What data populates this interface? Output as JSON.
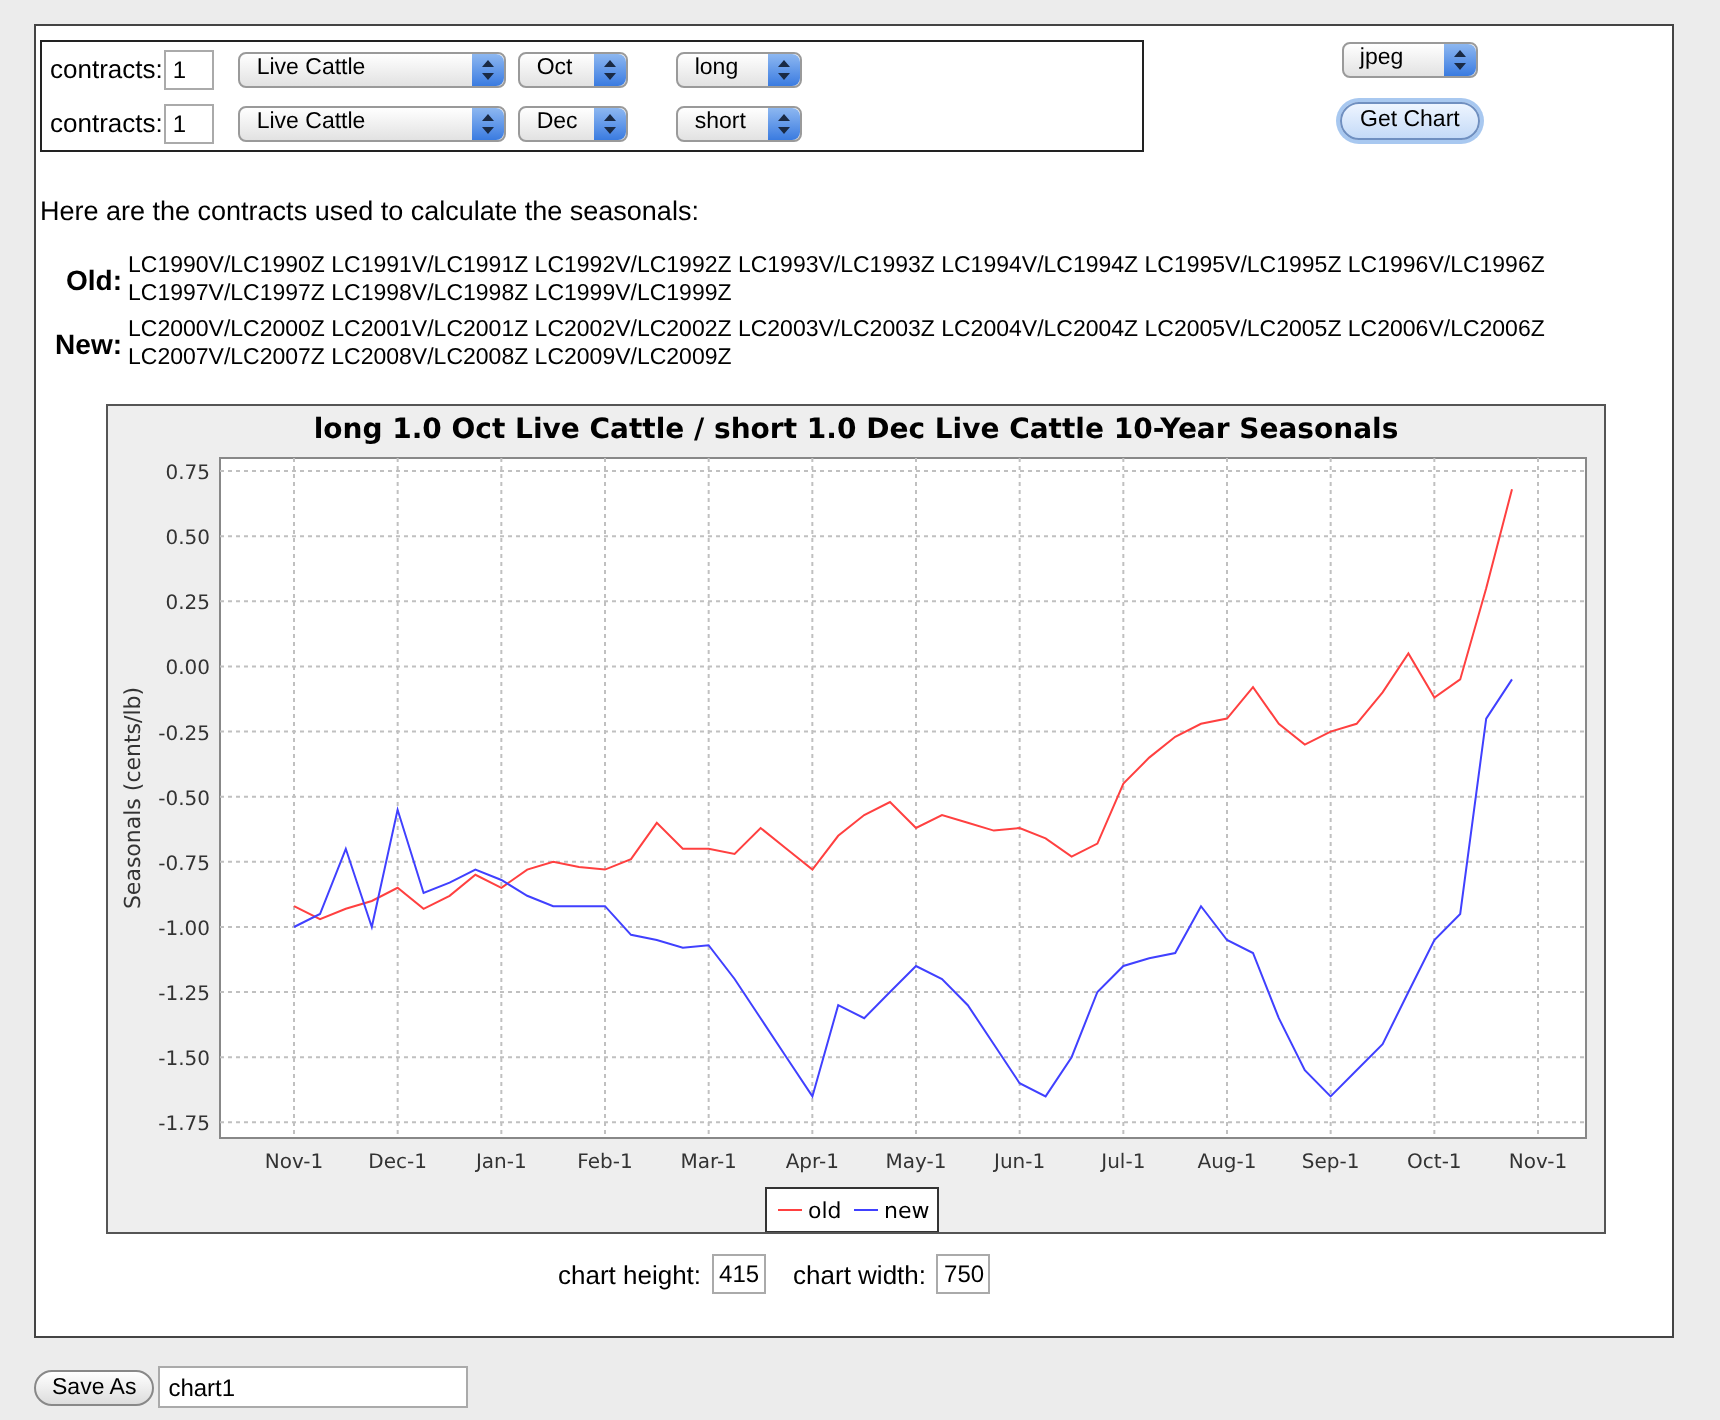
{
  "contract_rows": [
    {
      "label": "contracts:",
      "quantity": "1",
      "commodity": "Live Cattle",
      "month": "Oct",
      "side": "long"
    },
    {
      "label": "contracts:",
      "quantity": "1",
      "commodity": "Live Cattle",
      "month": "Dec",
      "side": "short"
    }
  ],
  "format_select": "jpeg",
  "get_chart_button": "Get Chart",
  "intro": "Here are the contracts used to calculate the seasonals:",
  "contract_lists": [
    {
      "label": "Old:",
      "text": "LC1990V/LC1990Z LC1991V/LC1991Z LC1992V/LC1992Z LC1993V/LC1993Z LC1994V/LC1994Z LC1995V/LC1995Z LC1996V/LC1996Z LC1997V/LC1997Z LC1998V/LC1998Z LC1999V/LC1999Z"
    },
    {
      "label": "New:",
      "text": "LC2000V/LC2000Z LC2001V/LC2001Z LC2002V/LC2002Z LC2003V/LC2003Z LC2004V/LC2004Z LC2005V/LC2005Z LC2006V/LC2006Z LC2007V/LC2007Z LC2008V/LC2008Z LC2009V/LC2009Z"
    }
  ],
  "chart": {
    "chart_data": {
      "type": "line",
      "title": "long 1.0 Oct Live Cattle / short 1.0 Dec Live Cattle 10-Year Seasonals",
      "ylabel": "Seasonals (cents/lb)",
      "ylim": [
        -1.81,
        0.8
      ],
      "grid": true,
      "legend": "bottom",
      "categories": [
        "Nov-1",
        null,
        null,
        null,
        "Dec-1",
        null,
        null,
        null,
        "Jan-1",
        null,
        null,
        null,
        "Feb-1",
        null,
        null,
        null,
        "Mar-1",
        null,
        null,
        null,
        "Apr-1",
        null,
        null,
        null,
        "May-1",
        null,
        null,
        null,
        "Jun-1",
        null,
        null,
        null,
        "Jul-1",
        null,
        null,
        null,
        "Aug-1",
        null,
        null,
        null,
        "Sep-1",
        null,
        null,
        null,
        "Oct-1",
        null,
        null,
        null,
        "Nov-1"
      ],
      "yticks": [
        {
          "value": 0.75,
          "label": "0.75"
        },
        {
          "value": 0.5,
          "label": "0.50"
        },
        {
          "value": 0.25,
          "label": "0.25"
        },
        {
          "value": 0,
          "label": "0.00"
        },
        {
          "value": -0.25,
          "label": "-0.25"
        },
        {
          "value": -0.5,
          "label": "-0.50"
        },
        {
          "value": -0.75,
          "label": "-0.75"
        },
        {
          "value": -1,
          "label": "-1.00"
        },
        {
          "value": -1.25,
          "label": "-1.25"
        },
        {
          "value": -1.5,
          "label": "-1.50"
        },
        {
          "value": -1.75,
          "label": "-1.75"
        }
      ],
      "series": [
        {
          "name": "old",
          "color": "#ff4040",
          "values": [
            -0.92,
            -0.97,
            -0.93,
            -0.9,
            -0.85,
            -0.93,
            -0.88,
            -0.8,
            -0.85,
            -0.78,
            -0.75,
            -0.77,
            -0.78,
            -0.74,
            -0.6,
            -0.7,
            -0.7,
            -0.72,
            -0.62,
            -0.7,
            -0.78,
            -0.65,
            -0.57,
            -0.52,
            -0.62,
            -0.57,
            -0.6,
            -0.63,
            -0.62,
            -0.66,
            -0.73,
            -0.68,
            -0.45,
            -0.35,
            -0.27,
            -0.22,
            -0.2,
            -0.08,
            -0.22,
            -0.3,
            -0.25,
            -0.22,
            -0.1,
            0.05,
            -0.12,
            -0.05,
            0.3,
            0.68,
            null
          ]
        },
        {
          "name": "new",
          "color": "#4040ff",
          "values": [
            -1.0,
            -0.95,
            -0.7,
            -1.0,
            -0.55,
            -0.87,
            -0.83,
            -0.78,
            -0.82,
            -0.88,
            -0.92,
            -0.92,
            -0.92,
            -1.03,
            -1.05,
            -1.08,
            -1.07,
            -1.2,
            -1.35,
            -1.5,
            -1.65,
            -1.3,
            -1.35,
            -1.25,
            -1.15,
            -1.2,
            -1.3,
            -1.45,
            -1.6,
            -1.65,
            -1.5,
            -1.25,
            -1.15,
            -1.12,
            -1.1,
            -0.92,
            -1.05,
            -1.1,
            -1.35,
            -1.55,
            -1.65,
            -1.55,
            -1.45,
            -1.25,
            -1.05,
            -0.95,
            -0.2,
            -0.05,
            null
          ]
        }
      ]
    }
  },
  "size_fields": [
    {
      "label": "chart height:",
      "value": "415"
    },
    {
      "label": "chart width:",
      "value": "750"
    }
  ],
  "save": {
    "button": "Save As",
    "value": "chart1"
  }
}
